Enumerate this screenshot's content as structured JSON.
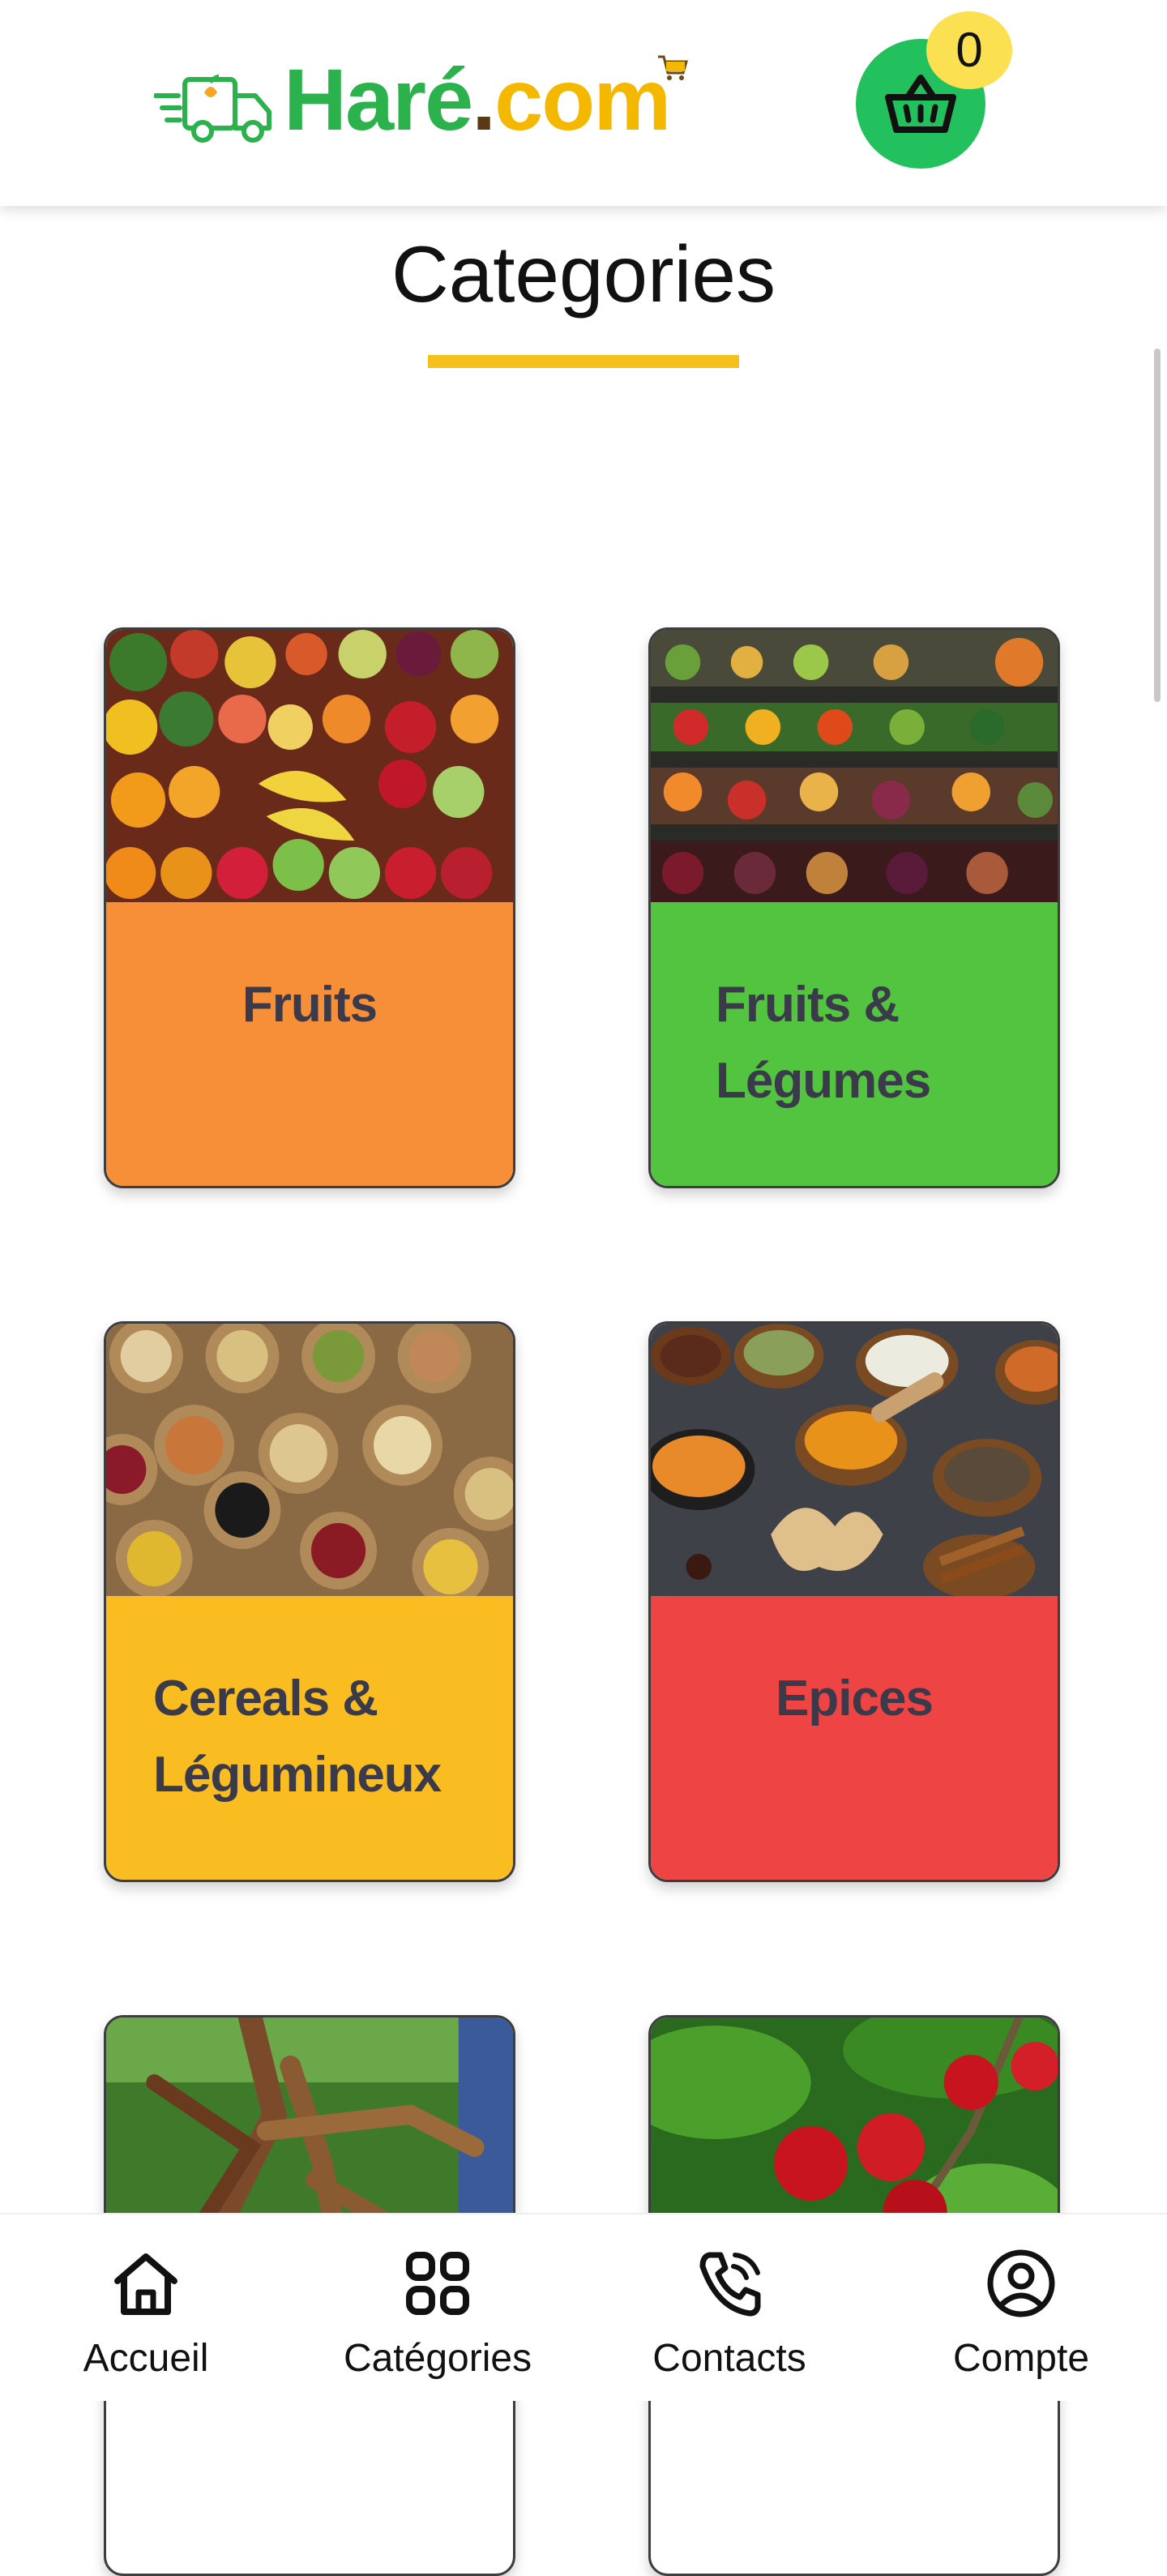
{
  "header": {
    "logo": {
      "part1": "Haré",
      "dot": ".",
      "part2": "com"
    },
    "cart_count": "0"
  },
  "page": {
    "title": "Categories"
  },
  "categories": [
    {
      "label_line1": "Fruits",
      "label_line2": "",
      "color": "#f78f39",
      "image": "fruit-market"
    },
    {
      "label_line1": "Fruits &",
      "label_line2": "Légumes",
      "color": "#52c43f",
      "image": "vegetable-market"
    },
    {
      "label_line1": "Cereals &",
      "label_line2": "Légumineux",
      "color": "#f9bd21",
      "image": "legume-sacks"
    },
    {
      "label_line1": "Epices",
      "label_line2": "",
      "color": "#ef4444",
      "image": "spice-bowls"
    },
    {
      "label_line1": "",
      "label_line2": "",
      "color": "",
      "image": "cassava-roots"
    },
    {
      "label_line1": "",
      "label_line2": "",
      "color": "",
      "image": "coffee-cherries"
    }
  ],
  "bottom_nav": [
    {
      "label": "Accueil",
      "icon": "home-icon"
    },
    {
      "label": "Catégories",
      "icon": "grid-icon"
    },
    {
      "label": "Contacts",
      "icon": "phone-icon"
    },
    {
      "label": "Compte",
      "icon": "user-circle-icon"
    }
  ],
  "colors": {
    "brand_green": "#2bb24c",
    "brand_yellow": "#f5b800",
    "accent_underline": "#f5c01b",
    "basket_green": "#22c15e",
    "badge_yellow": "#fbe152"
  }
}
